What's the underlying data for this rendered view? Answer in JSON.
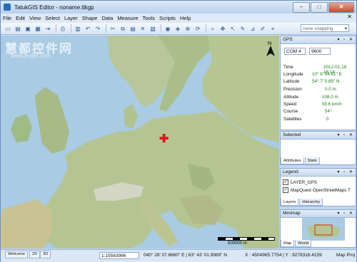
{
  "window": {
    "title": "TatukGIS Editor - noname.ttkgp",
    "controls": {
      "minimize": "–",
      "maximize": "□",
      "close": "✕"
    }
  },
  "menu": [
    "File",
    "Edit",
    "View",
    "Select",
    "Layer",
    "Shape",
    "Data",
    "Measure",
    "Tools",
    "Scripts",
    "Help"
  ],
  "toolbar": {
    "snap_value": "none snapping"
  },
  "map": {
    "watermark_cn": "慧都控件网",
    "watermark_url": "www.evget.com",
    "scale_label": "500000 m",
    "north_arrow_label": "N"
  },
  "gps": {
    "header": "GPS",
    "port": "COM 4",
    "baud": "9600",
    "rows": [
      {
        "label": "Time",
        "value": "2012-01-18 16:14:"
      },
      {
        "label": "Longitude",
        "value": "10° 9' 54.61\" E"
      },
      {
        "label": "Latitude",
        "value": "54° 7' 0.85\" N"
      },
      {
        "label": "Precision",
        "value": "0.0 m"
      },
      {
        "label": "Altitude",
        "value": "108.0 m"
      },
      {
        "label": "Speed",
        "value": "55.6 km/h"
      },
      {
        "label": "Course",
        "value": "54°"
      },
      {
        "label": "Satellites",
        "value": "0"
      }
    ]
  },
  "selected": {
    "header": "Selected",
    "tabs": [
      "Attributes",
      "Stats"
    ]
  },
  "legend": {
    "header": "Legend",
    "layers": [
      "LAYER_GPS",
      "MapQuest OpenStreetMaps T"
    ],
    "tabs": [
      "Layers",
      "Hierarchy"
    ]
  },
  "minimap": {
    "header": "Minimap",
    "tabs": [
      "Map",
      "World"
    ]
  },
  "status": {
    "view_tabs": [
      "Welcome",
      "2D",
      "3D"
    ],
    "scale": "1:15583986",
    "coords_dms": "040° 28' 07.6660\" E | 63° 43' 01.9989\" N",
    "xy": "X : 4504965.7754 | Y : 9278316.4159",
    "projection": "Map Proj"
  }
}
